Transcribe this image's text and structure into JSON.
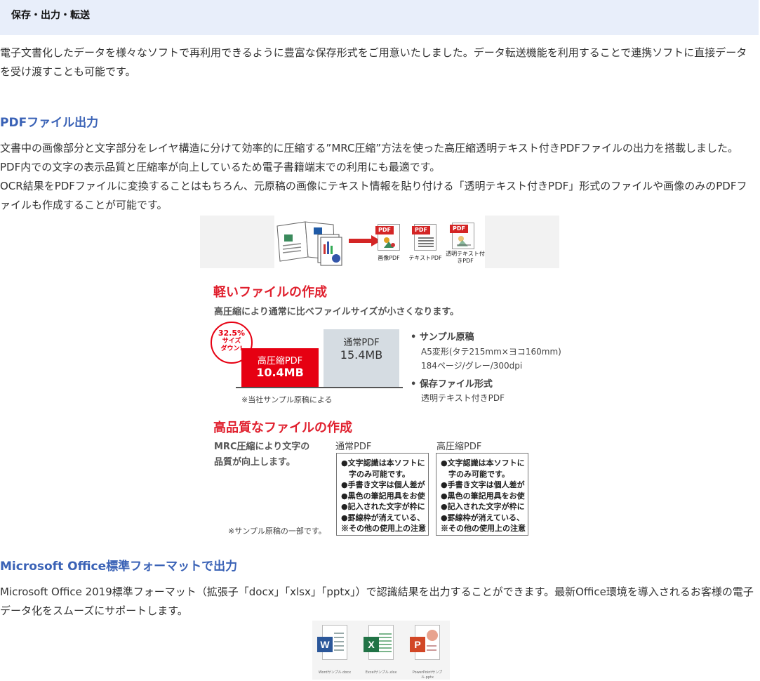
{
  "header": {
    "title": "保存・出力・転送"
  },
  "intro": {
    "text": "電子文書化したデータを様々なソフトで再利用できるように豊富な保存形式をご用意いたしました。データ転送機能を利用することで連携ソフトに直接データを受け渡すことも可能です。"
  },
  "pdf_section": {
    "heading": "PDFファイル出力",
    "para1": "文書中の画像部分と文字部分をレイヤ構造に分けて効率的に圧縮する”MRC圧縮”方法を使った高圧縮透明テキスト付きPDFファイルの出力を搭載しました。PDF内での文字の表示品質と圧縮率が向上しているため電子書籍端末での利用にも最適です。",
    "para2": "OCR結果をPDFファイルに変換することはもちろん、元原稿の画像にテキスト情報を貼り付ける「透明テキスト付きPDF」形式のファイルや画像のみのPDFファイルも作成することが可能です。",
    "strip": {
      "pdf_tag": "PDF",
      "labels": [
        "画像PDF",
        "テキストPDF",
        "透明テキスト付きPDF"
      ]
    },
    "light": {
      "heading": "軽いファイルの作成",
      "subtitle": "高圧縮により通常に比べファイルサイズが小さくなります。",
      "badge_line1": "32.5%",
      "badge_line2": "サイズ",
      "badge_line3": "ダウン!",
      "red_label": "高圧縮PDF",
      "red_value": "10.4MB",
      "grey_label": "通常PDF",
      "grey_value": "15.4MB",
      "note": "※当社サンプル原稿による",
      "spec1_title": "• サンプル原稿",
      "spec1_line1": "A5変形(タテ215mm×ヨコ160mm)",
      "spec1_line2": "184ページ/グレー/300dpi",
      "spec2_title": "• 保存ファイル形式",
      "spec2_line1": "透明テキスト付きPDF"
    },
    "quality": {
      "heading": "高品質なファイルの作成",
      "desc1": "MRC圧縮により文字の",
      "desc2": "品質が向上します。",
      "note": "※サンプル原稿の一部です。",
      "col1_title": "通常PDF",
      "col2_title": "高圧縮PDF",
      "sample_lines": [
        "●文字認識は本ソフトに",
        "　字のみ可能です。",
        "●手書き文字は個人差が",
        "●黒色の筆記用具をお使",
        "●記入された文字が枠に",
        "●罫線枠が消えている、",
        "※その他の使用上の注意"
      ]
    }
  },
  "office_section": {
    "heading": "Microsoft Office標準フォーマットで出力",
    "text": "Microsoft Office 2019標準フォーマット（拡張子「docx」「xlsx」「pptx」）で認識結果を出力することができます。最新Office環境を導入されるお客様の電子データ化をスムーズにサポートします。",
    "icons": [
      {
        "letter": "W",
        "caption": "Wordサンプル.docx",
        "color": "#2b579a"
      },
      {
        "letter": "X",
        "caption": "Excelサンプル.xlsx",
        "color": "#217346"
      },
      {
        "letter": "P",
        "caption": "PowerPointサンプル.pptx",
        "color": "#d24726"
      }
    ]
  }
}
